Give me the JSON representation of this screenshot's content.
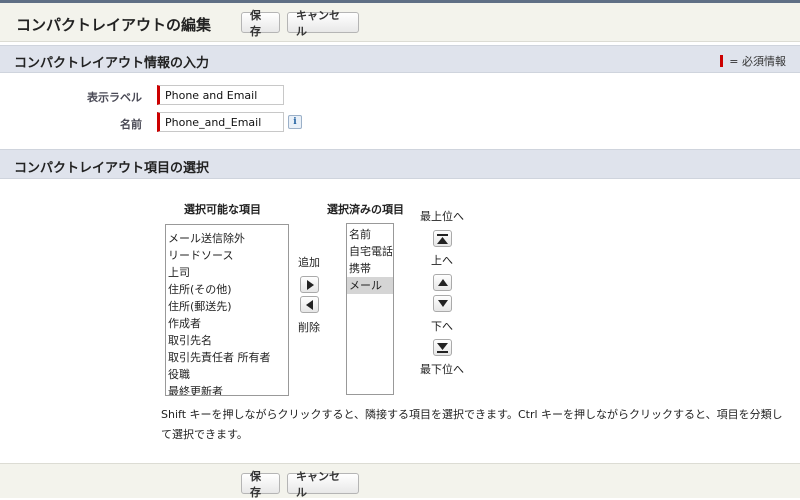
{
  "page": {
    "title": "コンパクトレイアウトの編集"
  },
  "toolbar": {
    "save_label": "保存",
    "cancel_label": "キャンセル"
  },
  "info_section": {
    "title": "コンパクトレイアウト情報の入力",
    "required_legend": "= 必須情報",
    "display_label": {
      "label": "表示ラベル",
      "value": "Phone and Email"
    },
    "api_name": {
      "label": "名前",
      "value": "Phone_and_Email"
    }
  },
  "fields_section": {
    "title": "コンパクトレイアウト項目の選択",
    "available": {
      "header": "選択可能な項目",
      "items": [
        "メール送信除外",
        "リードソース",
        "上司",
        "住所(その他)",
        "住所(郵送先)",
        "作成者",
        "取引先名",
        "取引先責任者 所有者",
        "役職",
        "最終更新者"
      ]
    },
    "selected": {
      "header": "選択済みの項目",
      "items": [
        "名前",
        "自宅電話",
        "携帯",
        "メール"
      ],
      "highlighted": "メール"
    },
    "add_label": "追加",
    "remove_label": "削除",
    "order": {
      "top": "最上位へ",
      "up": "上へ",
      "down": "下へ",
      "bottom": "最下位へ"
    },
    "hint": "Shift キーを押しながらクリックすると、隣接する項目を選択できます。Ctrl キーを押しながらクリックすると、項目を分類して選択できます。"
  },
  "colors": {
    "required": "#cc0000",
    "section_bg": "#dfe3ec",
    "header_bg": "#f3f3ec"
  },
  "icons": [
    "info-icon",
    "arrow-right-icon",
    "arrow-left-icon",
    "move-top-icon",
    "move-up-icon",
    "move-down-icon",
    "move-bottom-icon"
  ]
}
